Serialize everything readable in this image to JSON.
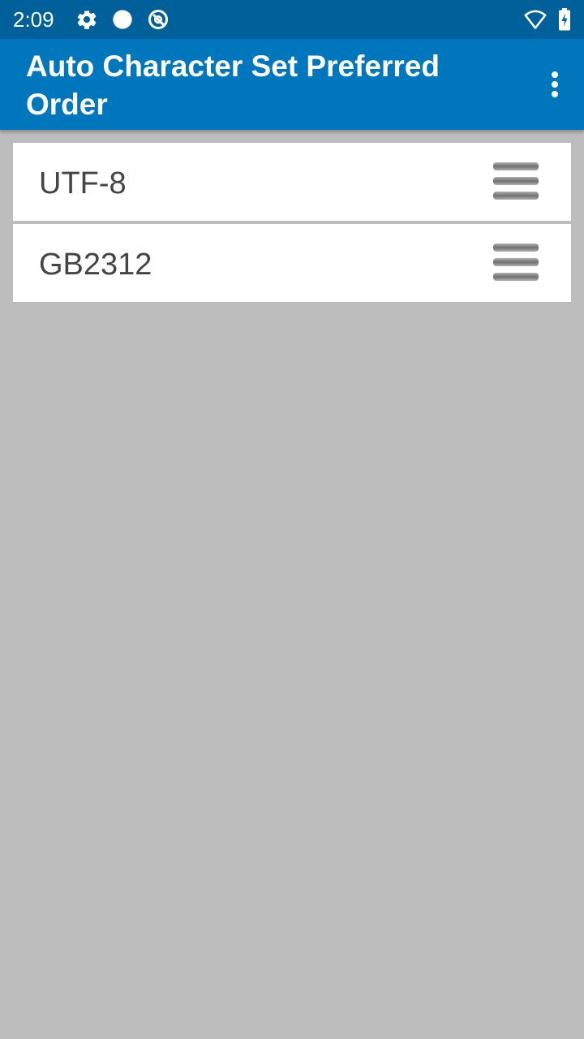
{
  "status_bar": {
    "time": "2:09",
    "left_icons": [
      "settings-gear-icon",
      "circle-icon",
      "data-saver-icon"
    ],
    "right_icons": [
      "wifi-icon",
      "battery-charging-icon"
    ]
  },
  "app_bar": {
    "title": "Auto Character Set Preferred Order",
    "overflow_icon": "more-vert-icon"
  },
  "list": {
    "items": [
      {
        "label": "UTF-8",
        "handle_icon": "drag-handle-icon"
      },
      {
        "label": "GB2312",
        "handle_icon": "drag-handle-icon"
      }
    ]
  },
  "colors": {
    "status_bar": "#00609a",
    "app_bar": "#0077bc",
    "background": "#bdbdbd",
    "item_background": "#ffffff",
    "item_text": "#444444"
  }
}
